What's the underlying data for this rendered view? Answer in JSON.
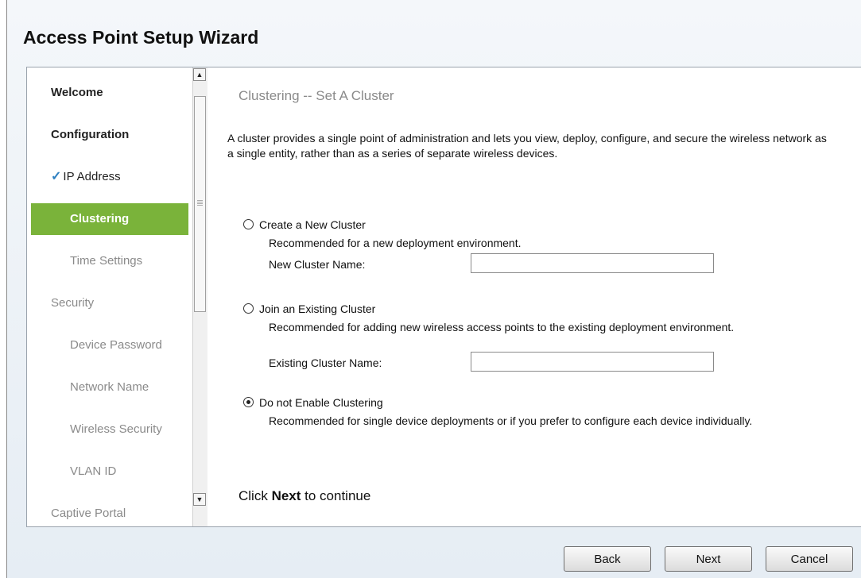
{
  "wizard": {
    "title": "Access Point Setup Wizard"
  },
  "nav": {
    "items": [
      {
        "label": "Welcome"
      },
      {
        "label": "Configuration"
      },
      {
        "label": "IP Address",
        "done": true
      },
      {
        "label": "Clustering",
        "active": true
      },
      {
        "label": "Time Settings"
      },
      {
        "label": "Security"
      },
      {
        "label": "Device Password"
      },
      {
        "label": "Network Name"
      },
      {
        "label": "Wireless Security"
      },
      {
        "label": "VLAN ID"
      },
      {
        "label": "Captive Portal"
      }
    ],
    "check_icon": "checkmark-icon"
  },
  "content": {
    "heading": "Clustering -- Set A Cluster",
    "description": "A cluster provides a single point of administration and lets you view, deploy, configure, and secure the wireless network as a single entity, rather than as a series of separate wireless devices.",
    "options": [
      {
        "label": "Create a New Cluster",
        "description": "Recommended for a new deployment environment.",
        "field_label": "New Cluster Name:",
        "field_value": "",
        "selected": false
      },
      {
        "label": "Join an Existing Cluster",
        "description": "Recommended for adding new wireless access points to the existing deployment environment.",
        "field_label": "Existing Cluster Name:",
        "field_value": "",
        "selected": false
      },
      {
        "label": "Do not Enable Clustering",
        "description": "Recommended for single device deployments or if you prefer to configure each device individually.",
        "selected": true
      }
    ],
    "hint_prefix": "Click ",
    "hint_bold": "Next",
    "hint_suffix": " to continue"
  },
  "buttons": {
    "back": "Back",
    "next": "Next",
    "cancel": "Cancel"
  },
  "colors": {
    "active_nav": "#7ab33a",
    "check": "#2d7fc0"
  }
}
